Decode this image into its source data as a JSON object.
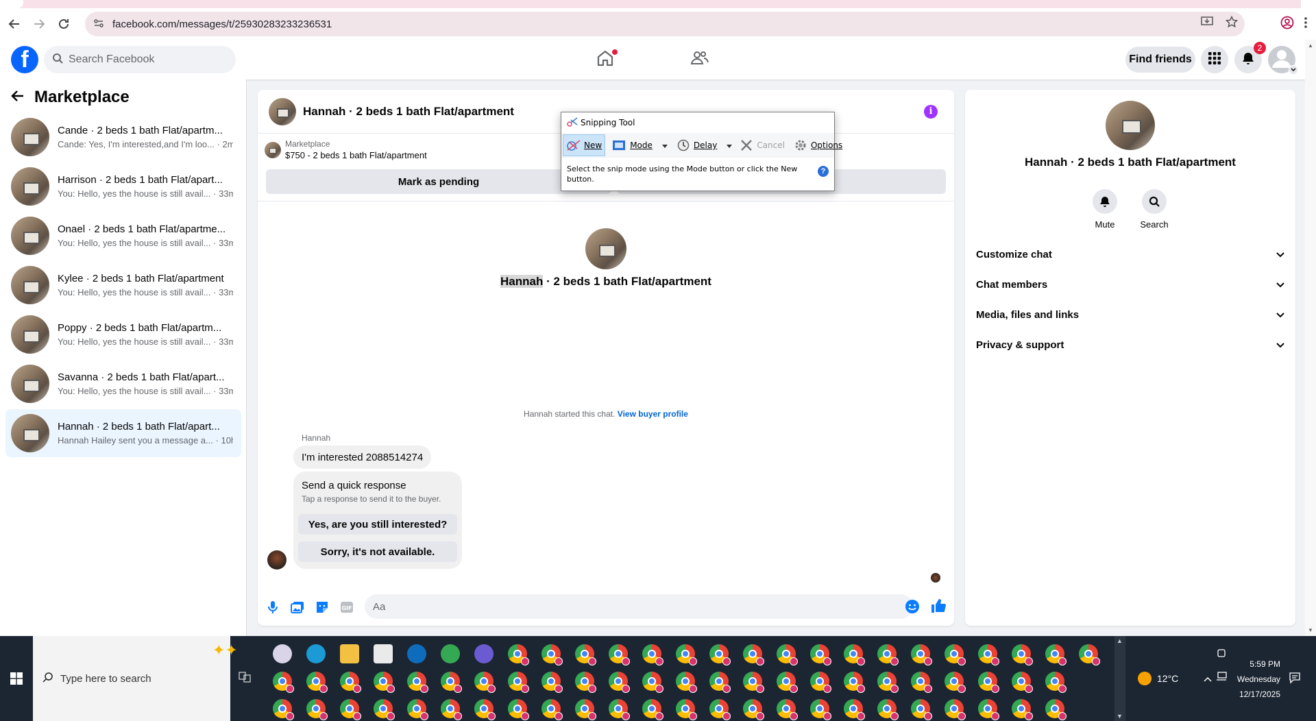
{
  "browser": {
    "url": "facebook.com/messages/t/25930283233236531"
  },
  "header": {
    "search_placeholder": "Search Facebook",
    "find_friends": "Find friends",
    "notification_count": "2"
  },
  "sidebar": {
    "title": "Marketplace",
    "conversations": [
      {
        "name": "Cande · 2 beds 1 bath Flat/apartm...",
        "snippet": "Cande: Yes, I'm interested,and I'm loo... · 2m"
      },
      {
        "name": "Harrison · 2 beds 1 bath Flat/apart...",
        "snippet": "You: Hello, yes the house is still avail... · 33m"
      },
      {
        "name": "Onael · 2 beds 1 bath Flat/apartme...",
        "snippet": "You: Hello, yes the house is still avail... · 33m"
      },
      {
        "name": "Kylee · 2 beds 1 bath Flat/apartment",
        "snippet": "You: Hello, yes the house is still avail... · 33m"
      },
      {
        "name": "Poppy · 2 beds 1 bath Flat/apartm...",
        "snippet": "You: Hello, yes the house is still avail... · 33m"
      },
      {
        "name": "Savanna · 2 beds 1 bath Flat/apart...",
        "snippet": "You: Hello, yes the house is still avail... · 33m"
      },
      {
        "name": "Hannah · 2 beds 1 bath Flat/apart...",
        "snippet": "Hannah Hailey sent you a message a... · 10h"
      }
    ]
  },
  "chat": {
    "title": "Hannah · 2 beds 1 bath Flat/apartment",
    "marketplace_label": "Marketplace",
    "listing": "$750 - 2 beds 1 bath Flat/apartment",
    "mark_pending": "Mark as pending",
    "center_name": "Hannah",
    "center_rest": " · 2 beds 1 bath Flat/apartment",
    "started_text": "Hannah started this chat.",
    "view_profile": "View buyer profile",
    "sender": "Hannah",
    "message": "I'm interested 2088514274",
    "quick_title": "Send a quick response",
    "quick_sub": "Tap a response to send it to the buyer.",
    "quick_1": "Yes, are you still interested?",
    "quick_2": "Sorry, it's not available.",
    "input_placeholder": "Aa"
  },
  "right_panel": {
    "title": "Hannah · 2 beds 1 bath Flat/apartment",
    "mute": "Mute",
    "search": "Search",
    "sections": [
      "Customize chat",
      "Chat members",
      "Media, files and links",
      "Privacy & support"
    ]
  },
  "snipping_tool": {
    "title": "Snipping Tool",
    "new": "New",
    "mode": "Mode",
    "delay": "Delay",
    "cancel": "Cancel",
    "options": "Options",
    "message": "Select the snip mode using the Mode button or click the New button."
  },
  "taskbar": {
    "search_placeholder": "Type here to search",
    "temperature": "12°C",
    "time": "5:59 PM",
    "day": "Wednesday",
    "date": "12/17/2025"
  },
  "colors": {
    "facebook_blue": "#0866ff",
    "active_conv": "#ebf5ff",
    "link": "#0064d1",
    "like_blue": "#0a7cff"
  }
}
